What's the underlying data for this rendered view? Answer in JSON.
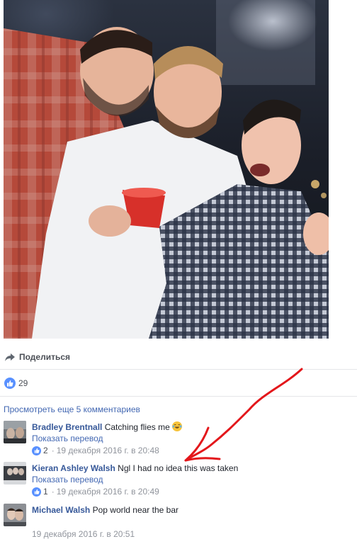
{
  "share": {
    "label": "Поделиться"
  },
  "likes": {
    "count": "29"
  },
  "comments": {
    "more_label": "Просмотреть еще 5 комментариев",
    "items": [
      {
        "author": "Bradley Brentnall",
        "text": "Catching flies me",
        "emoji": "laughing-tears",
        "translate": "Показать перевод",
        "likes": "2",
        "date": "19 декабря 2016 г. в 20:48"
      },
      {
        "author": "Kieran Ashley Walsh",
        "text": "Ngl I had no idea this was taken",
        "translate": "Показать перевод",
        "likes": "1",
        "date": "19 декабря 2016 г. в 20:49"
      },
      {
        "author": "Michael Walsh",
        "text": "Pop world near the bar",
        "date": "19 декабря 2016 г. в 20:51"
      }
    ]
  },
  "colors": {
    "link": "#4267b2",
    "author": "#365899",
    "like_blue": "#5890ff",
    "annotation_red": "#e3171b"
  }
}
